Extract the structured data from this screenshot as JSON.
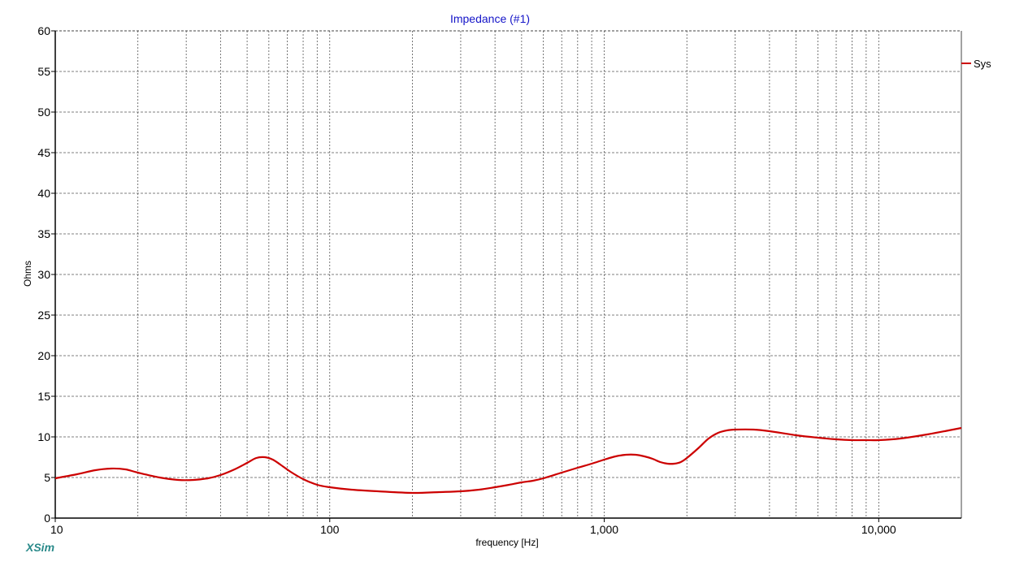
{
  "chart_data": {
    "type": "line",
    "title": "Impedance (#1)",
    "xlabel": "frequency [Hz]",
    "ylabel": "Ohms",
    "x_scale": "log",
    "xlim": [
      10,
      20000
    ],
    "ylim": [
      0,
      60
    ],
    "x_ticks": [
      10,
      100,
      1000,
      10000
    ],
    "x_tick_labels": [
      "10",
      "100",
      "1,000",
      "10,000"
    ],
    "y_ticks": [
      0,
      5,
      10,
      15,
      20,
      25,
      30,
      35,
      40,
      45,
      50,
      55,
      60
    ],
    "y_tick_labels": [
      "0",
      "5",
      "10",
      "15",
      "20",
      "25",
      "30",
      "35",
      "40",
      "45",
      "50",
      "55",
      "60"
    ],
    "grid": true,
    "legend": "right",
    "series": [
      {
        "name": "Sys",
        "color": "#cc0000",
        "x": [
          10,
          12,
          14,
          16,
          18,
          20,
          24,
          28,
          32,
          36,
          40,
          45,
          50,
          54,
          58,
          62,
          66,
          72,
          80,
          90,
          100,
          120,
          150,
          200,
          250,
          300,
          350,
          400,
          450,
          500,
          550,
          600,
          700,
          800,
          900,
          1000,
          1100,
          1200,
          1300,
          1400,
          1500,
          1600,
          1700,
          1800,
          1900,
          2000,
          2200,
          2400,
          2600,
          2800,
          3000,
          3500,
          4000,
          5000,
          6000,
          7000,
          8000,
          9000,
          10000,
          12000,
          15000,
          18000,
          20000
        ],
        "y": [
          4.9,
          5.4,
          5.9,
          6.1,
          6.0,
          5.6,
          5.0,
          4.7,
          4.7,
          4.9,
          5.3,
          6.0,
          6.8,
          7.4,
          7.5,
          7.2,
          6.6,
          5.7,
          4.8,
          4.1,
          3.8,
          3.5,
          3.3,
          3.1,
          3.2,
          3.3,
          3.5,
          3.8,
          4.1,
          4.4,
          4.6,
          4.9,
          5.6,
          6.2,
          6.7,
          7.2,
          7.6,
          7.8,
          7.8,
          7.6,
          7.3,
          6.9,
          6.7,
          6.7,
          6.9,
          7.4,
          8.6,
          9.8,
          10.5,
          10.8,
          10.9,
          10.9,
          10.7,
          10.2,
          9.9,
          9.7,
          9.6,
          9.6,
          9.6,
          9.8,
          10.3,
          10.8,
          11.1
        ]
      }
    ]
  },
  "brand": "XSim"
}
